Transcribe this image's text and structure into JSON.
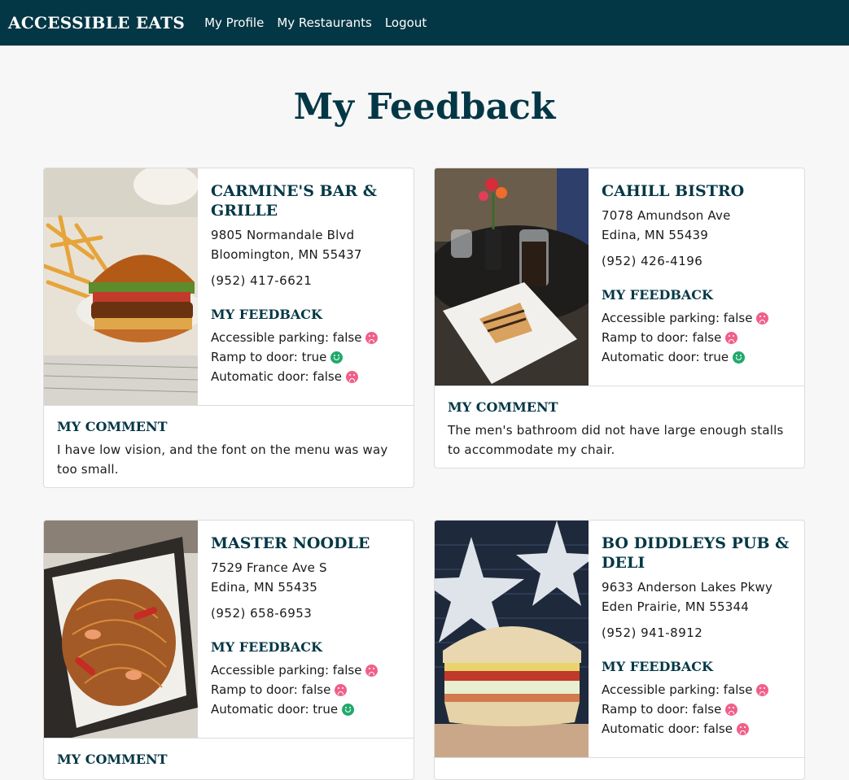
{
  "nav": {
    "brand": "ACCESSIBLE EATS",
    "links": [
      "My Profile",
      "My Restaurants",
      "Logout"
    ]
  },
  "page": {
    "title": "My Feedback"
  },
  "labels": {
    "feedback_heading": "MY FEEDBACK",
    "comment_heading": "MY COMMENT"
  },
  "restaurants": [
    {
      "name": "Carmine's Bar & Grille",
      "address1": "9805 Normandale Blvd",
      "address2": "Bloomington, MN 55437",
      "phone": "(952) 417-6621",
      "photo_icon": "burger-photo",
      "feedback": [
        {
          "label": "Accessible parking: false",
          "mood": "sad"
        },
        {
          "label": "Ramp to door: true",
          "mood": "happy"
        },
        {
          "label": "Automatic door: false",
          "mood": "sad"
        }
      ],
      "comment": "I have low vision, and the font on the menu was way too small."
    },
    {
      "name": "Cahill Bistro",
      "address1": "7078 Amundson Ave",
      "address2": "Edina, MN 55439",
      "phone": "(952) 426-4196",
      "photo_icon": "dessert-photo",
      "feedback": [
        {
          "label": "Accessible parking: false",
          "mood": "sad"
        },
        {
          "label": "Ramp to door: false",
          "mood": "sad"
        },
        {
          "label": "Automatic door: true",
          "mood": "happy"
        }
      ],
      "comment": "The men's bathroom did not have large enough stalls to accommodate my chair."
    },
    {
      "name": "Master Noodle",
      "address1": "7529 France Ave S",
      "address2": "Edina, MN 55435",
      "phone": "(952) 658-6953",
      "photo_icon": "noodles-photo",
      "feedback": [
        {
          "label": "Accessible parking: false",
          "mood": "sad"
        },
        {
          "label": "Ramp to door: false",
          "mood": "sad"
        },
        {
          "label": "Automatic door: true",
          "mood": "happy"
        }
      ],
      "comment": ""
    },
    {
      "name": "Bo Diddleys Pub & Deli",
      "address1": "9633 Anderson Lakes Pkwy",
      "address2": "Eden Prairie, MN 55344",
      "phone": "(952) 941-8912",
      "photo_icon": "sandwich-photo",
      "feedback": [
        {
          "label": "Accessible parking: false",
          "mood": "sad"
        },
        {
          "label": "Ramp to door: false",
          "mood": "sad"
        },
        {
          "label": "Automatic door: false",
          "mood": "sad"
        }
      ],
      "comment": ""
    }
  ]
}
